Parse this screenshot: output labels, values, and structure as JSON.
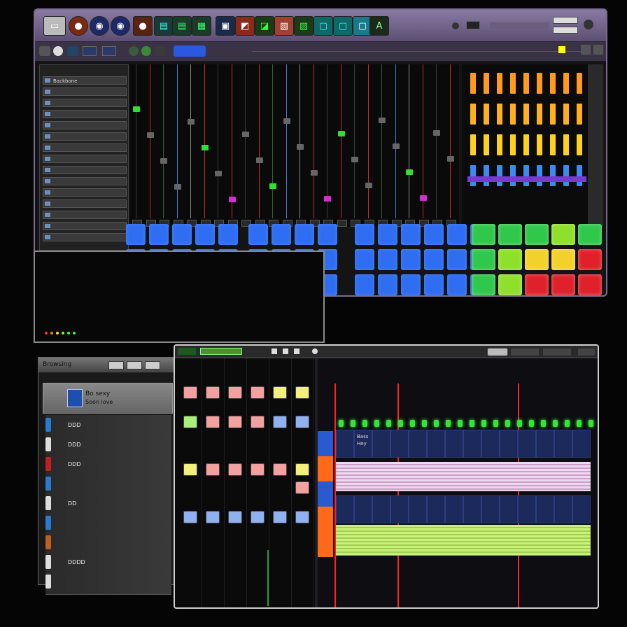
{
  "main_window": {
    "toolbar_icons": [
      "save-icon",
      "record-knob-icon",
      "knob-icon",
      "knob-icon",
      "record-icon",
      "screen-icon",
      "screen-icon",
      "screen-icon",
      "device-icon",
      "device-icon",
      "device-icon",
      "device-icon",
      "device-icon",
      "device-icon",
      "device-icon",
      "device-icon",
      "synth-icon"
    ],
    "toolbar_right_a": "",
    "toolbar_right_b": "",
    "browser_rows": [
      "Backbone",
      "",
      "",
      "",
      "",
      "",
      "",
      "",
      "",
      "",
      "",
      "",
      "",
      "",
      ""
    ],
    "colors": {
      "blue_pad": "#2f6df2",
      "green_pad": "#2fc84a",
      "red_pad": "#e0202a",
      "yellow_pad": "#f2d22a",
      "orange_meter": "#ff9a1a",
      "purple": "#7a6a92"
    }
  },
  "lib_window": {
    "title": "Browsing",
    "rows": [
      {
        "label": "Bo sexy",
        "sub": "Soon love"
      },
      {
        "label": "DDD"
      },
      {
        "label": "DDD"
      },
      {
        "label": "DDD"
      },
      {
        "label": ""
      },
      {
        "label": "DD"
      },
      {
        "label": ""
      },
      {
        "label": ""
      },
      {
        "label": "DDDD"
      },
      {
        "label": ""
      }
    ]
  },
  "seq_window": {
    "title_left": "",
    "lane_labels": [
      "Bass",
      "Hey"
    ]
  }
}
